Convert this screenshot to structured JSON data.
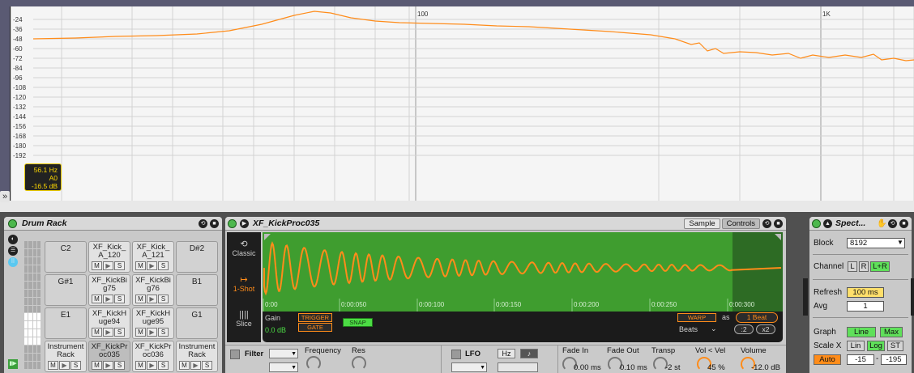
{
  "spectrum_graph": {
    "db_ticks": [
      "-24",
      "-36",
      "-48",
      "-60",
      "-72",
      "-84",
      "-96",
      "-108",
      "-120",
      "-132",
      "-144",
      "-156",
      "-168",
      "-180",
      "-192"
    ],
    "freq_labels": [
      "100",
      "1K"
    ],
    "cursor": {
      "freq": "56.1 Hz",
      "note": "A0",
      "level": "-16.5 dB"
    },
    "curve_color": "#ff8c1a"
  },
  "drum_rack": {
    "title": "Drum Rack",
    "pads": [
      {
        "name": "C2",
        "type": "note"
      },
      {
        "name": "XF_Kick_\nA_120",
        "type": "sample"
      },
      {
        "name": "XF_Kick_\nA_121",
        "type": "sample"
      },
      {
        "name": "D#2",
        "type": "note"
      },
      {
        "name": "G#1",
        "type": "note"
      },
      {
        "name": "XF_KickBi\ng75",
        "type": "sample"
      },
      {
        "name": "XF_KickBi\ng76",
        "type": "sample"
      },
      {
        "name": "B1",
        "type": "note"
      },
      {
        "name": "E1",
        "type": "note"
      },
      {
        "name": "XF_KickH\nuge94",
        "type": "sample"
      },
      {
        "name": "XF_KickH\nuge95",
        "type": "sample"
      },
      {
        "name": "G1",
        "type": "note"
      },
      {
        "name": "Instrument\nRack",
        "type": "sample"
      },
      {
        "name": "XF_KickPr\noc035",
        "type": "sample",
        "selected": true
      },
      {
        "name": "XF_KickPr\noc036",
        "type": "sample"
      },
      {
        "name": "Instrument\nRack",
        "type": "sample"
      }
    ],
    "pad_buttons": [
      "M",
      "▶",
      "S"
    ]
  },
  "simpler": {
    "title": "XF_KickProc035",
    "tabs": [
      "Sample",
      "Controls"
    ],
    "modes": [
      {
        "label": "Classic",
        "glyph": "⟲"
      },
      {
        "label": "1-Shot",
        "glyph": "↦"
      },
      {
        "label": "Slice",
        "glyph": "||||"
      }
    ],
    "time_labels": [
      "0:00",
      "0:00:050",
      "0:00:100",
      "0:00:150",
      "0:00:200",
      "0:00:250",
      "0:00:300"
    ],
    "gain_label": "Gain",
    "gain_value": "0.0 dB",
    "trigger": "TRIGGER",
    "gate": "GATE",
    "snap": "SNAP",
    "warp": "WARP",
    "as_label": "as",
    "beats_value": "1 Beat",
    "beats_dropdown": "Beats",
    "div": ":2",
    "mul": "x2",
    "filter_label": "Filter",
    "frequency_label": "Frequency",
    "res_label": "Res",
    "lfo_label": "LFO",
    "hz_label": "Hz",
    "note_glyph": "♪",
    "fade_in_label": "Fade In",
    "fade_in_value": "0.00 ms",
    "fade_out_label": "Fade Out",
    "fade_out_value": "0.10 ms",
    "transp_label": "Transp",
    "transp_value": "-2 st",
    "volvel_label": "Vol < Vel",
    "volvel_value": "45 %",
    "volume_label": "Volume",
    "volume_value": "-12.0 dB"
  },
  "spectrum_device": {
    "title": "Spect...",
    "block_label": "Block",
    "block_value": "8192",
    "channel_label": "Channel",
    "channel_options": [
      "L",
      "R",
      "L+R"
    ],
    "refresh_label": "Refresh",
    "refresh_value": "100 ms",
    "avg_label": "Avg",
    "avg_value": "1",
    "graph_label": "Graph",
    "graph_options": [
      "Line",
      "Max"
    ],
    "scalex_label": "Scale X",
    "scalex_options": [
      "Lin",
      "Log",
      "ST"
    ],
    "auto_label": "Auto",
    "range_low": "-15",
    "range_high": "-195"
  }
}
